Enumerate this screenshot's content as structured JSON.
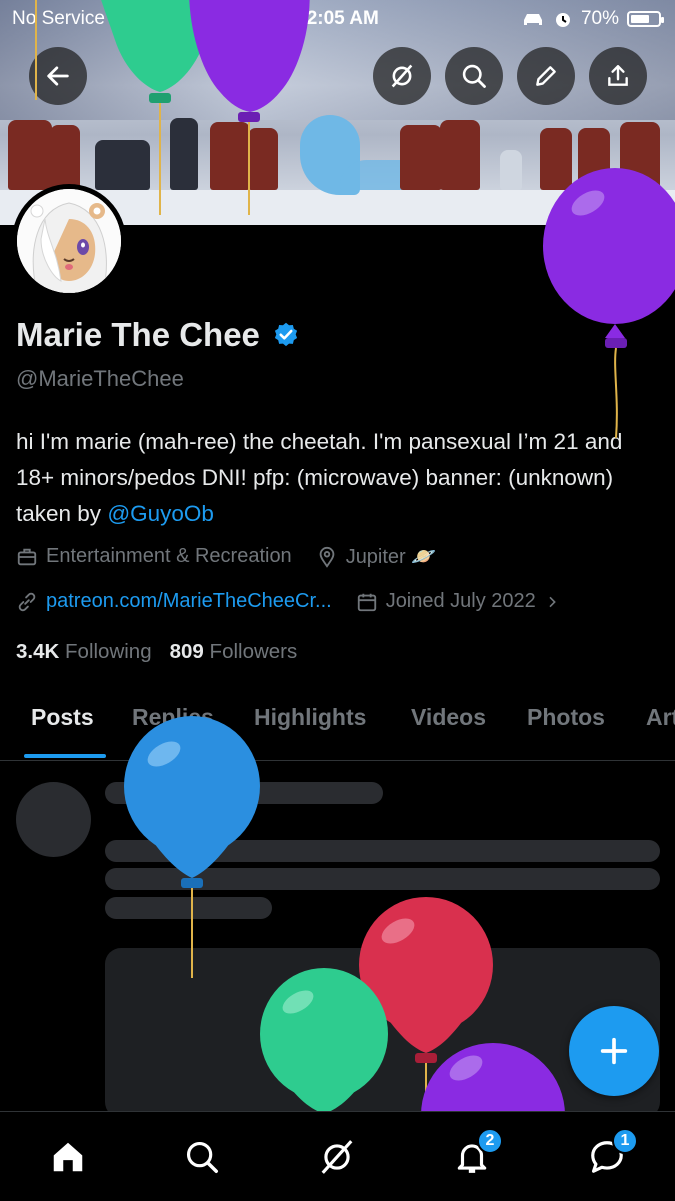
{
  "status_bar": {
    "carrier": "No Service",
    "time": "12:05 AM",
    "battery_percent": "70%",
    "battery_level": 0.7
  },
  "header": {
    "buttons": [
      {
        "icon": "back-arrow-icon"
      },
      {
        "icon": "grok-icon"
      },
      {
        "icon": "search-icon"
      },
      {
        "icon": "pencil-icon"
      },
      {
        "icon": "share-icon"
      }
    ]
  },
  "profile": {
    "display_name": "Marie The Chee",
    "verified": true,
    "handle": "@MarieTheChee",
    "bio_text": "hi I'm marie (mah-ree) the cheetah. I'm pansexual I’m 21 and 18+ minors/pedos DNI! pfp: (microwave) banner: (unknown) taken by ",
    "bio_mention": "@GuyoOb",
    "category": "Entertainment & Recreation",
    "location": "Jupiter 🪐",
    "website": "patreon.com/MarieTheCheeCr...",
    "joined": "Joined July 2022",
    "following_count": "3.4K",
    "following_label": "Following",
    "followers_count": "809",
    "followers_label": "Followers"
  },
  "tabs": [
    {
      "label": "Posts",
      "active": true
    },
    {
      "label": "Replies",
      "active": false
    },
    {
      "label": "Highlights",
      "active": false
    },
    {
      "label": "Videos",
      "active": false
    },
    {
      "label": "Photos",
      "active": false
    },
    {
      "label": "Articles",
      "active": false
    }
  ],
  "bottom_nav": {
    "items": [
      {
        "icon": "home-icon",
        "badge": ""
      },
      {
        "icon": "search-icon",
        "badge": ""
      },
      {
        "icon": "grok-icon",
        "badge": ""
      },
      {
        "icon": "bell-icon",
        "badge": "2"
      },
      {
        "icon": "messages-icon",
        "badge": "1"
      }
    ]
  },
  "colors": {
    "accent": "#1d9bf0",
    "background": "#000000",
    "text_primary": "#e7e9ea",
    "text_secondary": "#71767b",
    "balloon_purple": "#8a2be2",
    "balloon_green": "#2ecc8f",
    "balloon_blue": "#2b8fe0",
    "balloon_red": "#d9304e"
  }
}
